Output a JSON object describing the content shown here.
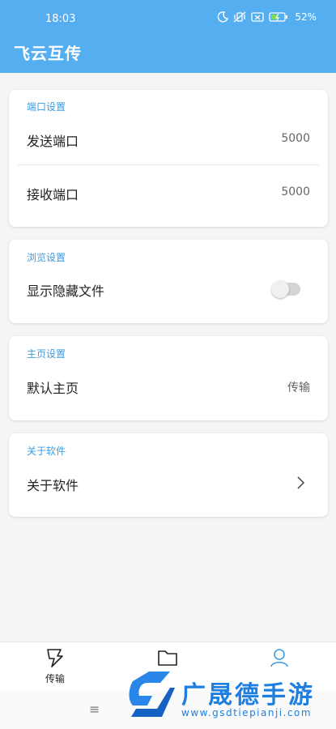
{
  "status_bar": {
    "time": "18:03",
    "battery": "52%"
  },
  "app": {
    "title": "飞云互传",
    "accent_color": "#54aef0"
  },
  "sections": {
    "port": {
      "header": "端口设置",
      "send_label": "发送端口",
      "send_value": "5000",
      "receive_label": "接收端口",
      "receive_value": "5000"
    },
    "browse": {
      "header": "浏览设置",
      "show_hidden_label": "显示隐藏文件",
      "show_hidden_enabled": false
    },
    "home": {
      "header": "主页设置",
      "default_home_label": "默认主页",
      "default_home_value": "传输"
    },
    "about": {
      "header": "关于软件",
      "about_label": "关于软件"
    }
  },
  "bottom_nav": {
    "items": [
      {
        "label": "传输",
        "icon": "transfer-icon"
      },
      {
        "label": "",
        "icon": "folder-icon"
      },
      {
        "label": "",
        "icon": "user-icon",
        "active": true
      }
    ]
  },
  "system_nav": {
    "menu": "≡"
  },
  "watermark": {
    "text": "广晟德手游",
    "url": "www.gsdtiepianji.com"
  }
}
